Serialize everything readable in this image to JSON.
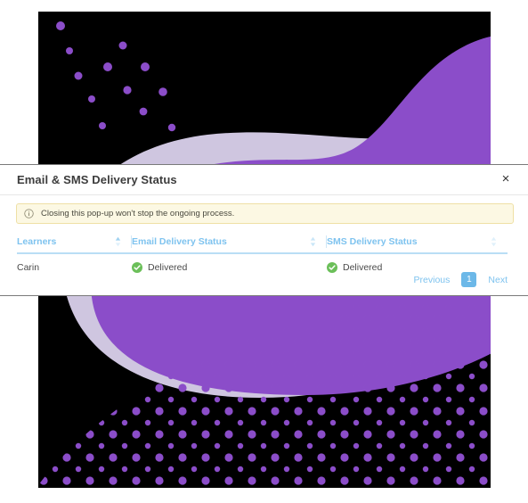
{
  "background": {
    "canvas_color": "#000000",
    "blob_purple": "#8b4dc9",
    "blob_lavender": "#cfc6e0",
    "dot_color": "#8b4dc9",
    "description": "abstract-purple-blob-artwork"
  },
  "modal": {
    "title": "Email & SMS Delivery Status",
    "close_label": "×",
    "close_icon": "close-icon",
    "banner": {
      "icon": "info-circle-icon",
      "text": "Closing this pop-up won't stop the ongoing process.",
      "background_color": "#fcf8e3",
      "border_color": "#efe0a5"
    },
    "table": {
      "accent_color": "#7ec3ef",
      "columns": [
        {
          "label": "Learners",
          "sort_icon": "sort-ascending-icon",
          "sort_state": "asc"
        },
        {
          "label": "Email Delivery Status",
          "sort_icon": "sort-icon",
          "sort_state": "none"
        },
        {
          "label": "SMS Delivery Status",
          "sort_icon": "sort-icon",
          "sort_state": "none"
        }
      ],
      "rows": [
        {
          "learner": "Carin",
          "email_status": "Delivered",
          "email_status_icon": "check-circle-icon",
          "sms_status": "Delivered",
          "sms_status_icon": "check-circle-icon",
          "status_color": "#6bbf59"
        }
      ]
    },
    "pagination": {
      "previous_label": "Previous",
      "current_page": "1",
      "next_label": "Next",
      "active_color": "#6cb8e8"
    }
  }
}
